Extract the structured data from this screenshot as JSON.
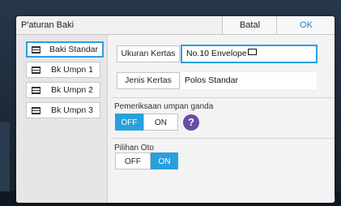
{
  "dialog": {
    "title": "P'aturan Baki",
    "cancel_label": "Batal",
    "ok_label": "OK"
  },
  "sidebar": {
    "items": [
      {
        "label": "Baki Standar",
        "selected": true
      },
      {
        "label": "Bk Umpn 1",
        "selected": false
      },
      {
        "label": "Bk Umpn 2",
        "selected": false
      },
      {
        "label": "Bk Umpn 3",
        "selected": false
      }
    ]
  },
  "paper_size": {
    "button_label": "Ukuran Kertas",
    "value": "No.10 Envelope"
  },
  "paper_type": {
    "button_label": "Jenis Kertas",
    "value": "Polos Standar"
  },
  "double_feed": {
    "label": "Pemeriksaan umpan ganda",
    "off_label": "OFF",
    "on_label": "ON",
    "state": "OFF",
    "help_label": "?"
  },
  "auto_select": {
    "label": "Pilihan Oto",
    "off_label": "OFF",
    "on_label": "ON",
    "state": "ON"
  },
  "colors": {
    "accent": "#2aa0dd",
    "help": "#6a4ca5"
  }
}
